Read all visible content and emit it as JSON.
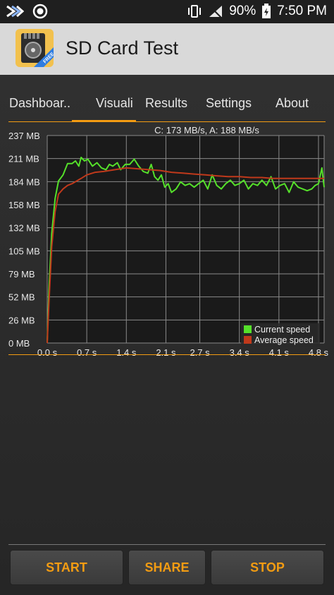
{
  "status_bar": {
    "battery": "90%",
    "time": "7:50 PM",
    "icons": [
      "app-launcher-icon",
      "record-icon",
      "vibrate-icon",
      "signal-icon",
      "battery-charging-icon"
    ]
  },
  "app_bar": {
    "title": "SD Card Test",
    "icon_badge": "FREE"
  },
  "tabs": [
    {
      "label": "Dashboar..",
      "active": false
    },
    {
      "label": "Visuali",
      "active": true
    },
    {
      "label": "Results",
      "active": false
    },
    {
      "label": "Settings",
      "active": false
    },
    {
      "label": "About",
      "active": false
    }
  ],
  "buttons": {
    "start": "START",
    "share": "SHARE",
    "stop": "STOP"
  },
  "colors": {
    "accent": "#f39c12",
    "current_speed": "#55e02a",
    "average_speed": "#c0391b"
  },
  "chart_data": {
    "type": "line",
    "title": "C: 173 MB/s, A: 188 MB/s",
    "xlabel": "",
    "ylabel": "",
    "x_ticks": [
      "0.0 s",
      "0.7 s",
      "1.4 s",
      "2.1 s",
      "2.7 s",
      "3.4 s",
      "4.1 s",
      "4.8 s"
    ],
    "y_ticks": [
      "0 MB",
      "26 MB",
      "52 MB",
      "79 MB",
      "105 MB",
      "132 MB",
      "158 MB",
      "184 MB",
      "211 MB",
      "237 MB"
    ],
    "xlim": [
      0,
      4.9
    ],
    "ylim": [
      0,
      237
    ],
    "grid": true,
    "legend": "bottom-right",
    "series": [
      {
        "name": "Current speed",
        "x": [
          0,
          0.03,
          0.08,
          0.14,
          0.2,
          0.28,
          0.36,
          0.44,
          0.5,
          0.56,
          0.6,
          0.66,
          0.72,
          0.8,
          0.88,
          0.96,
          1.04,
          1.1,
          1.16,
          1.24,
          1.3,
          1.38,
          1.46,
          1.54,
          1.62,
          1.7,
          1.78,
          1.84,
          1.9,
          1.96,
          2.02,
          2.08,
          2.14,
          2.2,
          2.28,
          2.36,
          2.44,
          2.52,
          2.6,
          2.68,
          2.76,
          2.84,
          2.92,
          3.0,
          3.08,
          3.16,
          3.24,
          3.32,
          3.4,
          3.48,
          3.56,
          3.64,
          3.72,
          3.8,
          3.88,
          3.96,
          4.04,
          4.12,
          4.2,
          4.28,
          4.36,
          4.44,
          4.52,
          4.6,
          4.68,
          4.74,
          4.8,
          4.86,
          4.9
        ],
        "y": [
          0,
          60,
          125,
          165,
          185,
          192,
          205,
          205,
          208,
          202,
          212,
          208,
          210,
          202,
          206,
          200,
          198,
          204,
          202,
          206,
          198,
          204,
          204,
          210,
          202,
          196,
          194,
          204,
          190,
          186,
          192,
          178,
          182,
          172,
          176,
          184,
          180,
          182,
          178,
          182,
          186,
          176,
          192,
          180,
          176,
          182,
          186,
          180,
          182,
          186,
          176,
          182,
          180,
          186,
          180,
          190,
          176,
          180,
          182,
          172,
          184,
          178,
          176,
          174,
          176,
          180,
          182,
          200,
          178
        ]
      },
      {
        "name": "Average speed",
        "x": [
          0,
          0.03,
          0.08,
          0.14,
          0.2,
          0.28,
          0.36,
          0.44,
          0.52,
          0.6,
          0.7,
          0.85,
          1.0,
          1.2,
          1.4,
          1.6,
          1.8,
          2.0,
          2.2,
          2.4,
          2.6,
          2.8,
          3.0,
          3.2,
          3.4,
          3.6,
          3.8,
          4.0,
          4.2,
          4.4,
          4.6,
          4.8,
          4.9
        ],
        "y": [
          0,
          45,
          110,
          150,
          170,
          176,
          180,
          182,
          185,
          188,
          192,
          195,
          196,
          198,
          200,
          199,
          198,
          197,
          195,
          194,
          193,
          192,
          191,
          190,
          190,
          189,
          189,
          188,
          188,
          188,
          188,
          188,
          188
        ]
      }
    ]
  }
}
